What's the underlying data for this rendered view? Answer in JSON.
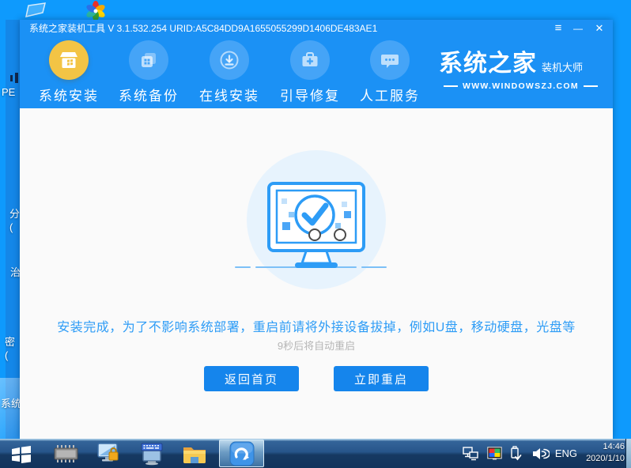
{
  "window": {
    "title": "系统之家装机工具 V 3.1.532.254 URID:A5C84DD9A1655055299D1406DE483AE1",
    "controls": {
      "menu": "≡",
      "minimize": "—",
      "close": "✕"
    }
  },
  "nav": {
    "items": [
      {
        "label": "系统安装",
        "icon": "install-box-icon",
        "active": true
      },
      {
        "label": "系统备份",
        "icon": "backup-windows-icon",
        "active": false
      },
      {
        "label": "在线安装",
        "icon": "online-download-icon",
        "active": false
      },
      {
        "label": "引导修复",
        "icon": "boot-repair-toolbox-icon",
        "active": false
      },
      {
        "label": "人工服务",
        "icon": "chat-service-icon",
        "active": false
      }
    ],
    "logo": {
      "brand": "系统之家",
      "sub": "装机大师",
      "site": "WWW.WINDOWSZJ.COM"
    }
  },
  "content": {
    "message": "安装完成，为了不影响系统部署，重启前请将外接设备拔掉，例如U盘，移动硬盘，光盘等",
    "countdown": "9秒后将自动重启",
    "buttons": {
      "home": "返回首页",
      "restart": "立即重启"
    }
  },
  "background": {
    "fragments": [
      "PE",
      "分\n(",
      "治",
      "密\n(",
      "系统"
    ]
  },
  "taskbar": {
    "language": "ENG",
    "time": "14:46",
    "date": "2020/1/10"
  },
  "colors": {
    "desktop_blue": "#0e9afd",
    "window_blue": "#1b91f5",
    "accent_blue": "#2d9cf6",
    "active_gold": "#f3c445",
    "button_blue": "#1585ec",
    "illustration_fill": "#e7f3fd",
    "countdown_gray": "#b5b5b5"
  }
}
